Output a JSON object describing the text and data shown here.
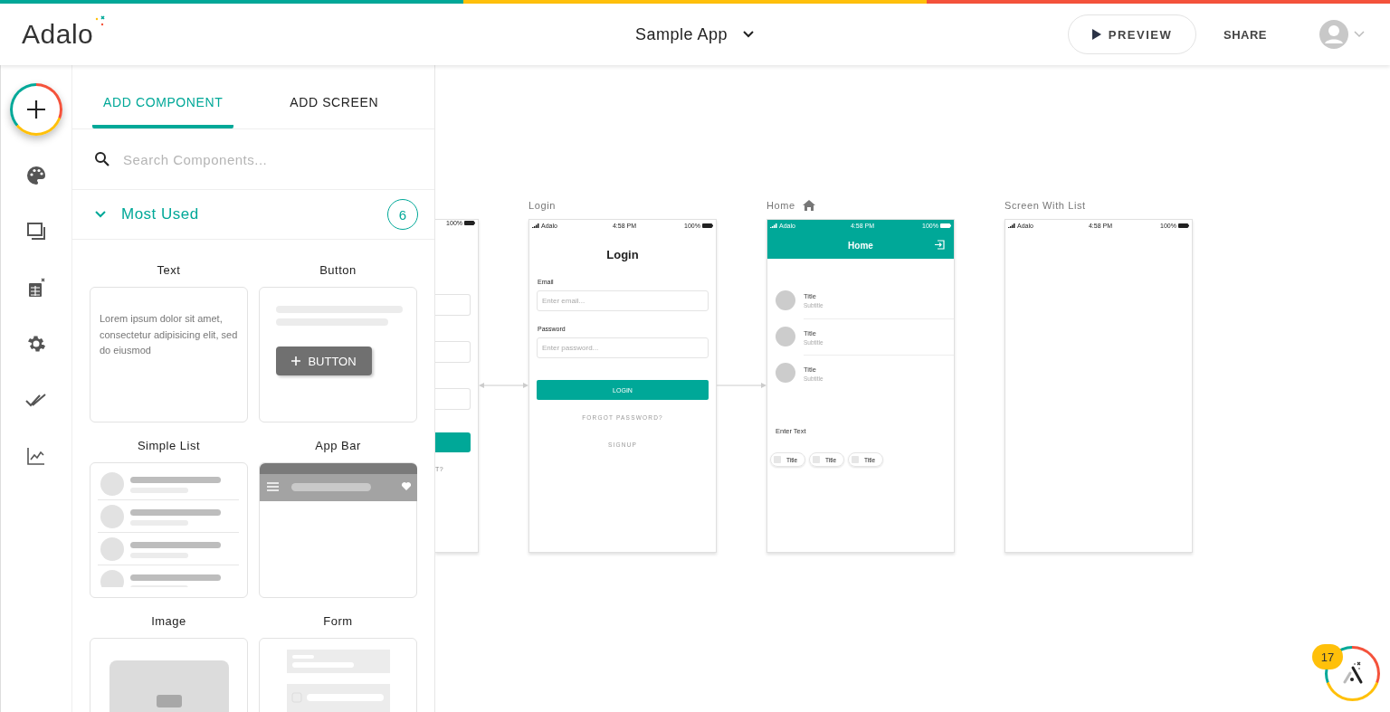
{
  "top_bar": {
    "logo": "Adalo",
    "app_name": "Sample App",
    "preview": "PREVIEW",
    "share": "SHARE"
  },
  "rail": {
    "items": [
      {
        "kind": "add"
      },
      {
        "kind": "palette"
      },
      {
        "kind": "screens"
      },
      {
        "kind": "database"
      },
      {
        "kind": "settings"
      },
      {
        "kind": "checks"
      },
      {
        "kind": "analytics"
      }
    ]
  },
  "panel": {
    "tabs": [
      {
        "label": "ADD COMPONENT",
        "selected": true
      },
      {
        "label": "ADD SCREEN",
        "selected": false
      }
    ],
    "search": {
      "placeholder": "Search Components..."
    },
    "section": {
      "title": "Most Used",
      "expanded": true,
      "count": "6"
    },
    "components": [
      {
        "name": "Text",
        "kind": "text",
        "preview_text": "Lorem ipsum dolor sit amet, consectetur adipisicing elit, sed do eiusmod"
      },
      {
        "name": "Button",
        "kind": "button",
        "button_label": "BUTTON"
      },
      {
        "name": "Simple List",
        "kind": "list"
      },
      {
        "name": "App Bar",
        "kind": "appbar"
      },
      {
        "name": "Image",
        "kind": "image"
      },
      {
        "name": "Form",
        "kind": "form"
      }
    ]
  },
  "canvas": {
    "screens": [
      {
        "kind": "partial",
        "battery": "100%",
        "link": "T?"
      },
      {
        "kind": "login",
        "title": "Login",
        "home": false,
        "carrier": "Adalo",
        "time": "4:58 PM",
        "battery": "100%",
        "heading": "Login",
        "fields": [
          {
            "label": "Email",
            "placeholder": "Enter email..."
          },
          {
            "label": "Password",
            "placeholder": "Enter password..."
          }
        ],
        "button": "LOGIN",
        "links": [
          "FORGOT PASSWORD?",
          "SIGNUP"
        ]
      },
      {
        "kind": "home",
        "title": "Home",
        "home": true,
        "carrier": "Adalo",
        "time": "4:58 PM",
        "battery": "100%",
        "heading": "Home",
        "items": [
          {
            "title": "Title",
            "subtitle": "Subtitle"
          },
          {
            "title": "Title",
            "subtitle": "Subtitle"
          },
          {
            "title": "Title",
            "subtitle": "Subtitle"
          }
        ],
        "text": "Enter Text",
        "chips": [
          "Title",
          "Title",
          "Title"
        ]
      },
      {
        "kind": "blank",
        "title": "Screen With List",
        "home": false,
        "carrier": "Adalo",
        "time": "4:58 PM",
        "battery": "100%"
      }
    ]
  },
  "help": {
    "count": "17"
  }
}
